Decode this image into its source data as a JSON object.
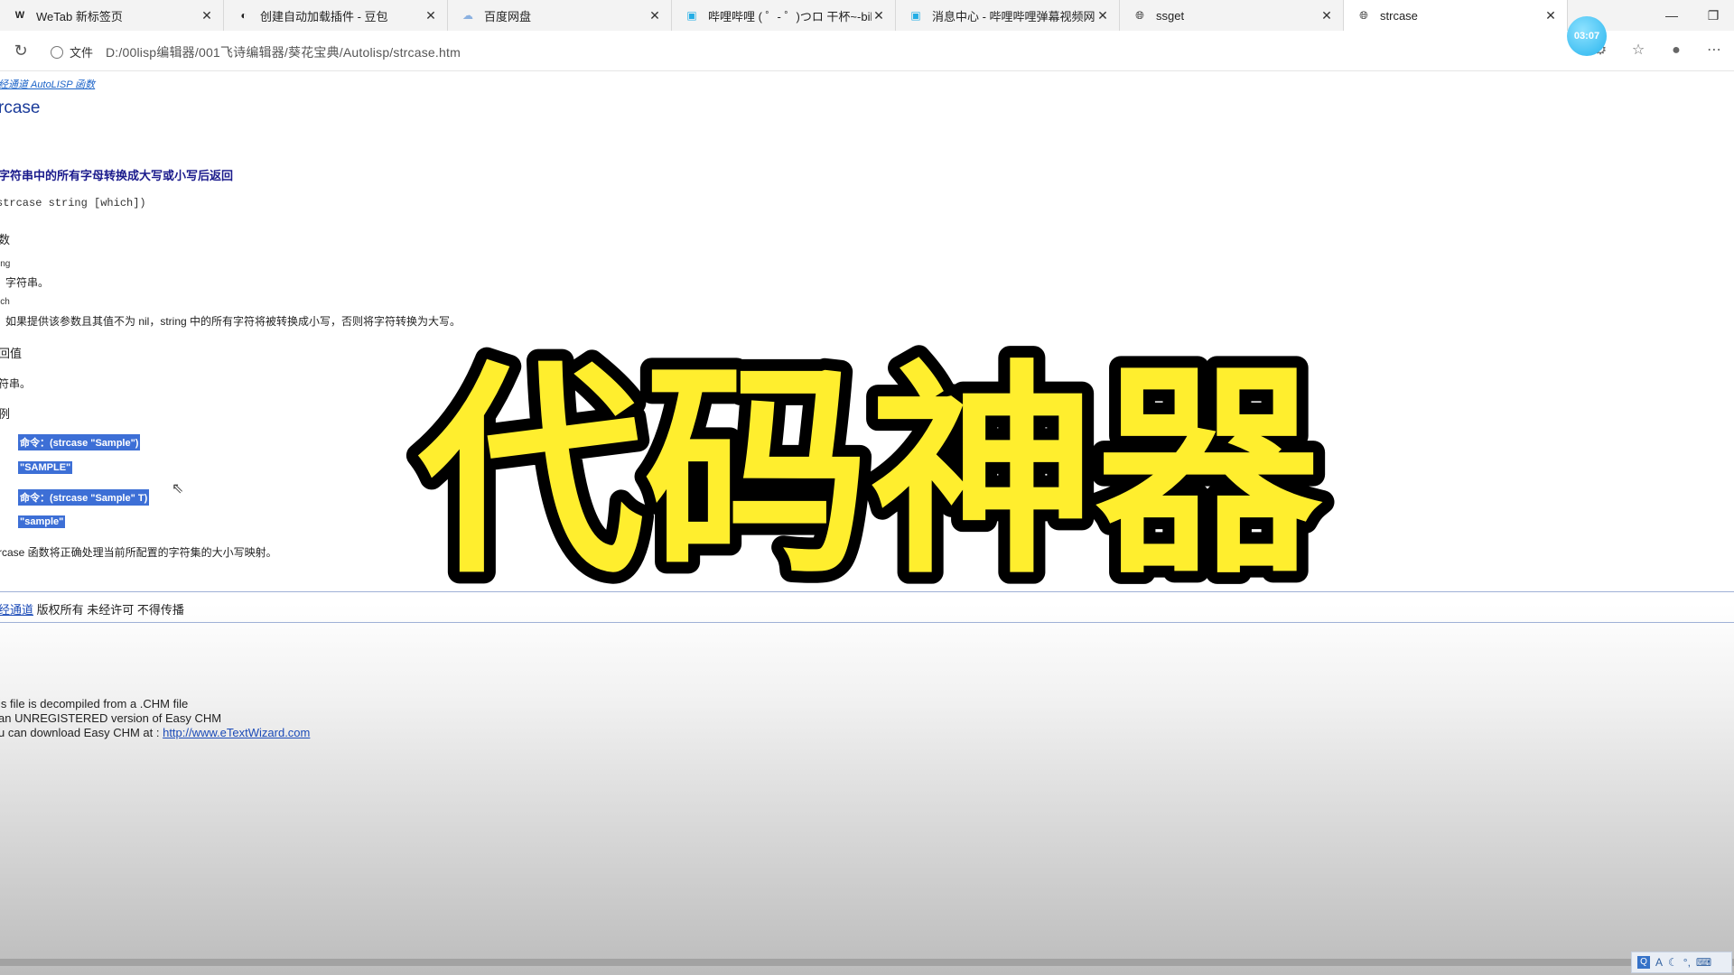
{
  "tabs": [
    {
      "title": "WeTab 新标签页",
      "icon": "wetab-icon",
      "active": false
    },
    {
      "title": "创建自动加载插件 - 豆包",
      "icon": "doubao-icon",
      "active": false
    },
    {
      "title": "百度网盘",
      "icon": "baidu-netdisk-icon",
      "active": false
    },
    {
      "title": "哔哩哔哩 ( ゜- ゜)つロ 干杯~-bilib",
      "icon": "bilibili-icon",
      "active": false
    },
    {
      "title": "消息中心 - 哔哩哔哩弹幕视频网",
      "icon": "bilibili-icon",
      "active": false
    },
    {
      "title": "ssget",
      "icon": "globe-icon",
      "active": false
    },
    {
      "title": "strcase",
      "icon": "globe-icon",
      "active": true
    }
  ],
  "address": {
    "site_label": "文件",
    "url": "D:/00lisp编辑器/001飞诗编辑器/葵花宝典/Autolisp/strcase.htm"
  },
  "timer": "03:07",
  "page": {
    "breadcrumb": "经通道 AutoLISP 函数",
    "title": "rcase",
    "summary": "字符串中的所有字母转换成大写或小写后返回",
    "syntax": "strcase string [which])",
    "params_heading": "数",
    "param1_name": "ing",
    "param1_desc": "字符串。",
    "param2_name": "ich",
    "param2_desc": "如果提供该参数且其值不为 nil，string 中的所有字符将被转换成小写，否则将字符转换为大写。",
    "return_heading": "回值",
    "return_desc": "符串。",
    "examples_heading": "例",
    "examples": [
      "命令：(strcase \"Sample\")",
      "\"SAMPLE\"",
      "命令：(strcase \"Sample\" T)",
      "\"sample\""
    ],
    "note": "rcase 函数将正确处理当前所配置的字符集的大小写映射。",
    "copyright_link": "经通道",
    "copyright_text": " 版权所有 未经许可 不得传播",
    "decompiled_line1": "is file is decompiled from a .CHM file",
    "decompiled_line2": " an UNREGISTERED version of Easy CHM",
    "decompiled_line3": "u can download Easy CHM at : ",
    "decompiled_link": "http://www.eTextWizard.com"
  },
  "overlay_text": "代码神器",
  "colors": {
    "overlay_fill": "#ffee2e",
    "overlay_stroke": "#000000",
    "selection": "#3d6fd6",
    "link": "#1b4bb8"
  }
}
